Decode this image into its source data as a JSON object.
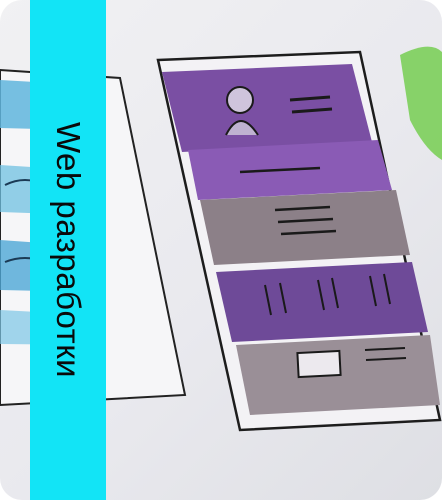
{
  "banner": {
    "title": "Web разработки"
  },
  "colors": {
    "band": "#12e4f6",
    "watercolor_purple": "#7a4fa3",
    "watercolor_gray": "#8c8088",
    "watercolor_blue": "#3f9fd0",
    "watercolor_green": "#7ccf5a"
  },
  "icons": [
    "wireframe-sketch-illustration"
  ]
}
